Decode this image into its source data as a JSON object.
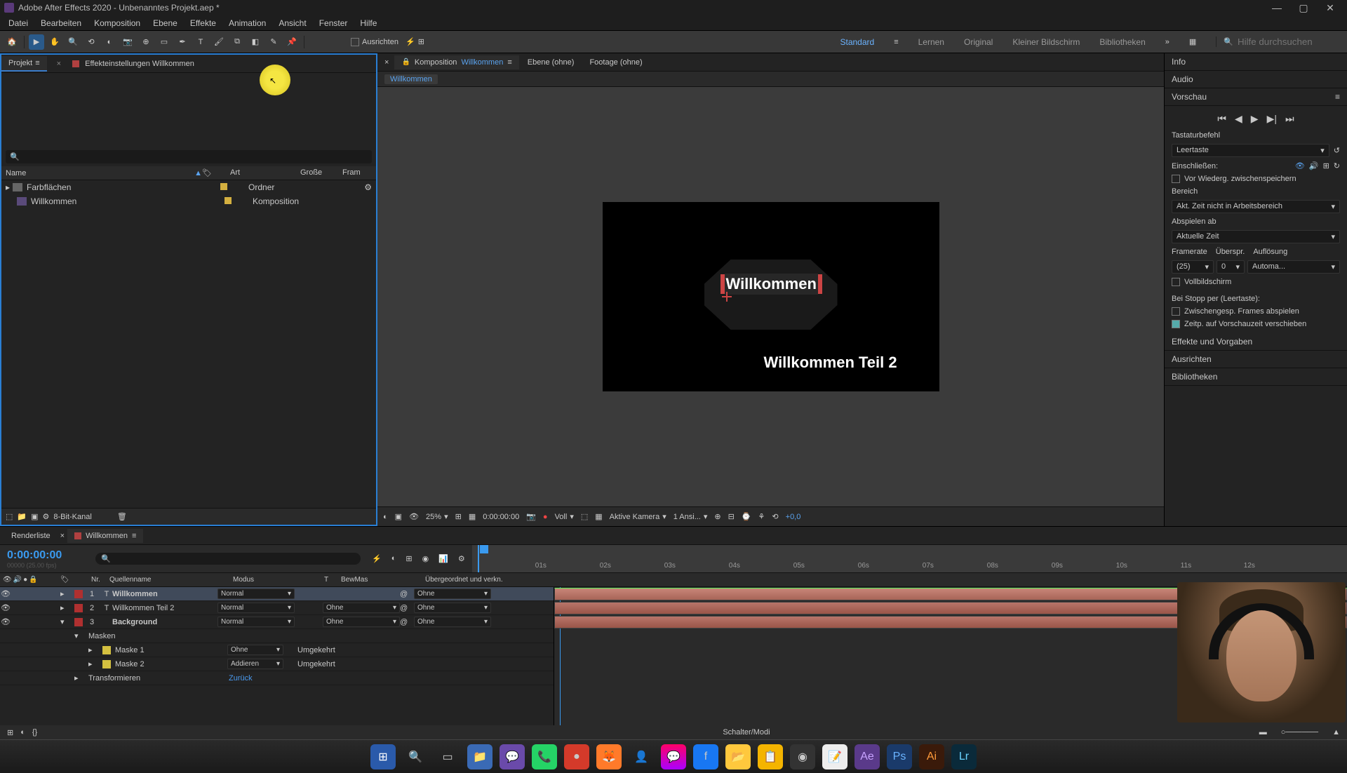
{
  "app": {
    "title": "Adobe After Effects 2020 - Unbenanntes Projekt.aep *"
  },
  "menu": [
    "Datei",
    "Bearbeiten",
    "Komposition",
    "Ebene",
    "Effekte",
    "Animation",
    "Ansicht",
    "Fenster",
    "Hilfe"
  ],
  "toolbar": {
    "snap_label": "Ausrichten"
  },
  "workspaces": {
    "items": [
      "Standard",
      "Lernen",
      "Original",
      "Kleiner Bildschirm",
      "Bibliotheken"
    ],
    "active": "Standard",
    "search_placeholder": "Hilfe durchsuchen"
  },
  "project_panel": {
    "tab_project": "Projekt",
    "tab_effects": "Effekteinstellungen Willkommen",
    "columns": {
      "name": "Name",
      "art": "Art",
      "size": "Große",
      "frame": "Fram"
    },
    "items": [
      {
        "name": "Farbflächen",
        "art": "Ordner",
        "icon": "folder"
      },
      {
        "name": "Willkommen",
        "art": "Komposition",
        "icon": "comp"
      }
    ],
    "bit_label": "8-Bit-Kanal"
  },
  "comp_panel": {
    "tab_comp_prefix": "Komposition",
    "tab_comp_name": "Willkommen",
    "tab_layer": "Ebene (ohne)",
    "tab_footage": "Footage (ohne)",
    "flow": "Willkommen",
    "text1": "Willkommen",
    "text2": "Willkommen Teil 2",
    "controls": {
      "zoom": "25%",
      "time": "0:00:00:00",
      "res": "Voll",
      "camera": "Aktive Kamera",
      "views": "1 Ansi...",
      "exposure": "+0,0"
    }
  },
  "right": {
    "info": "Info",
    "audio": "Audio",
    "preview": "Vorschau",
    "shortcut": "Tastaturbefehl",
    "shortcut_val": "Leertaste",
    "include": "Einschließen:",
    "cache_before": "Vor Wiederg. zwischenspeichern",
    "range": "Bereich",
    "range_val": "Akt. Zeit nicht in Arbeitsbereich",
    "play_from": "Abspielen ab",
    "play_from_val": "Aktuelle Zeit",
    "framerate": "Framerate",
    "skip": "Überspr.",
    "resolution": "Auflösung",
    "fr_val": "(25)",
    "skip_val": "0",
    "res_val": "Automa...",
    "fullscreen": "Vollbildschirm",
    "stop": "Bei Stopp per (Leertaste):",
    "stop_cache": "Zwischengesp. Frames abspielen",
    "stop_move": "Zeitp. auf Vorschauzeit verschieben",
    "effects": "Effekte und Vorgaben",
    "align": "Ausrichten",
    "libs": "Bibliotheken"
  },
  "timeline": {
    "tabs": {
      "render": "Renderliste",
      "comp": "Willkommen"
    },
    "timecode": "0:00:00:00",
    "fps_info": "00000 (25.00 fps)",
    "ruler": [
      "01s",
      "02s",
      "03s",
      "04s",
      "05s",
      "06s",
      "07s",
      "08s",
      "09s",
      "10s",
      "11s",
      "12s"
    ],
    "cols": {
      "nr": "Nr.",
      "source": "Quellenname",
      "mode": "Modus",
      "t": "T",
      "trkmat": "BewMas",
      "parent": "Übergeordnet und verkn."
    },
    "layers": [
      {
        "nr": "1",
        "name": "Willkommen",
        "mode": "Normal",
        "trkmat": "",
        "parent": "Ohne",
        "color": "#b03030",
        "type": "T",
        "selected": true
      },
      {
        "nr": "2",
        "name": "Willkommen Teil 2",
        "mode": "Normal",
        "trkmat": "Ohne",
        "parent": "Ohne",
        "color": "#b03030",
        "type": "T"
      },
      {
        "nr": "3",
        "name": "Background",
        "mode": "Normal",
        "trkmat": "Ohne",
        "parent": "Ohne",
        "color": "#b03030",
        "type": ""
      }
    ],
    "masks_label": "Masken",
    "mask1": "Maske 1",
    "mask1_mode": "Ohne",
    "mask1_inv": "Umgekehrt",
    "mask2": "Maske 2",
    "mask2_mode": "Addieren",
    "mask2_inv": "Umgekehrt",
    "transform": "Transformieren",
    "transform_reset": "Zurück",
    "footer": "Schalter/Modi"
  }
}
